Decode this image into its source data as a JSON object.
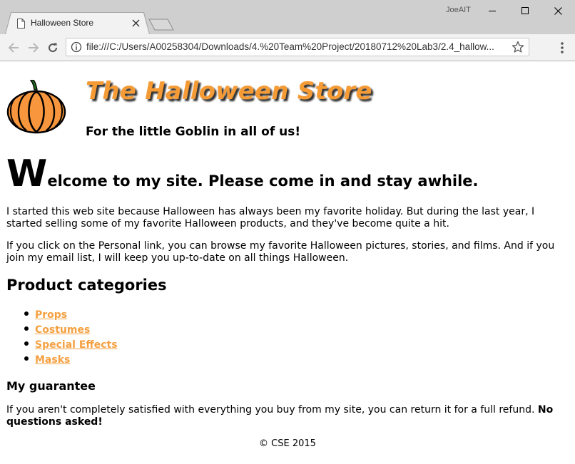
{
  "browser": {
    "tab_title": "Halloween Store",
    "profile_name": "JoeAIT",
    "url": "file:///C:/Users/A00258304/Downloads/4.%20Team%20Project/20180712%20Lab3/2.4_hallow..."
  },
  "header": {
    "title": "The Halloween Store",
    "tagline": "For the little Goblin in all of us!"
  },
  "welcome": {
    "dropcap": "W",
    "rest": "elcome to my site. Please come in and stay awhile."
  },
  "intro": {
    "p1": "I started this web site because Halloween has always been my favorite holiday. But during the last year, I started selling some of my favorite Halloween products, and they've become quite a hit.",
    "p2": "If you click on the Personal link, you can browse my favorite Halloween pictures, stories, and films. And if you join my email list, I will keep you up-to-date on all things Halloween."
  },
  "categories": {
    "heading": "Product categories",
    "items": [
      "Props",
      "Costumes",
      "Special Effects",
      "Masks"
    ]
  },
  "guarantee": {
    "heading": "My guarantee",
    "text": "If you aren't completely satisfied with everything you buy from my site, you can return it for a full refund. ",
    "emphasis": "No questions asked!"
  },
  "footer": {
    "text": "© CSE 2015"
  },
  "colors": {
    "title_orange": "#f59b36",
    "link_orange": "#f5a040",
    "pumpkin": "#f7963c"
  }
}
